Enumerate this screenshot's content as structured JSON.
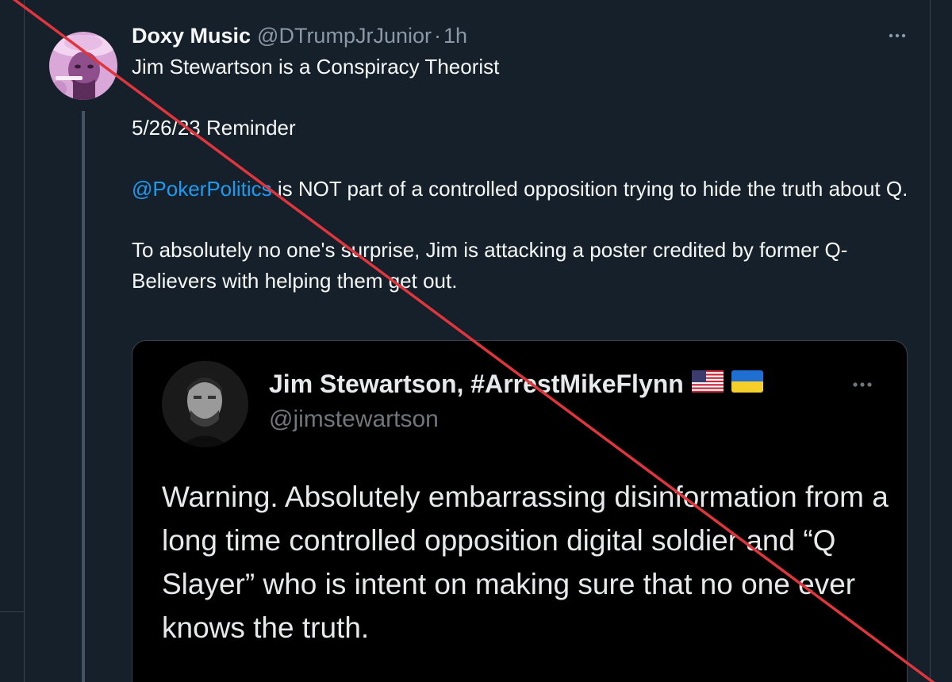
{
  "tweet": {
    "display_name": "Doxy Music",
    "handle": "@DTrumpJrJunior",
    "separator": "·",
    "time": "1h",
    "line1": "Jim Stewartson is a Conspiracy Theorist",
    "line2": "5/26/23 Reminder",
    "mention": "@PokerPolitics",
    "line3_rest": " is NOT part of a controlled opposition trying to hide the truth about Q.",
    "line4": "To absolutely no one's surprise, Jim is attacking a poster credited by former Q-Believers with helping them get out."
  },
  "quote": {
    "display_name": "Jim Stewartson, #ArrestMikeFlynn",
    "flags": [
      "us-flag-icon",
      "ukraine-flag-icon"
    ],
    "handle": "@jimstewartson",
    "text": "Warning. Absolutely embarrassing disinformation from a long time controlled opposition digital soldier and “Q Slayer” who is intent on making sure that no one ever knows the truth."
  },
  "icons": {
    "more_top": "more-horizontal-icon",
    "more_quote": "more-horizontal-icon"
  },
  "colors": {
    "background": "#15202b",
    "quote_background": "#000000",
    "mention": "#1d9bf0",
    "secondary_text": "#8b98a5",
    "slash_line": "#e0353d"
  }
}
